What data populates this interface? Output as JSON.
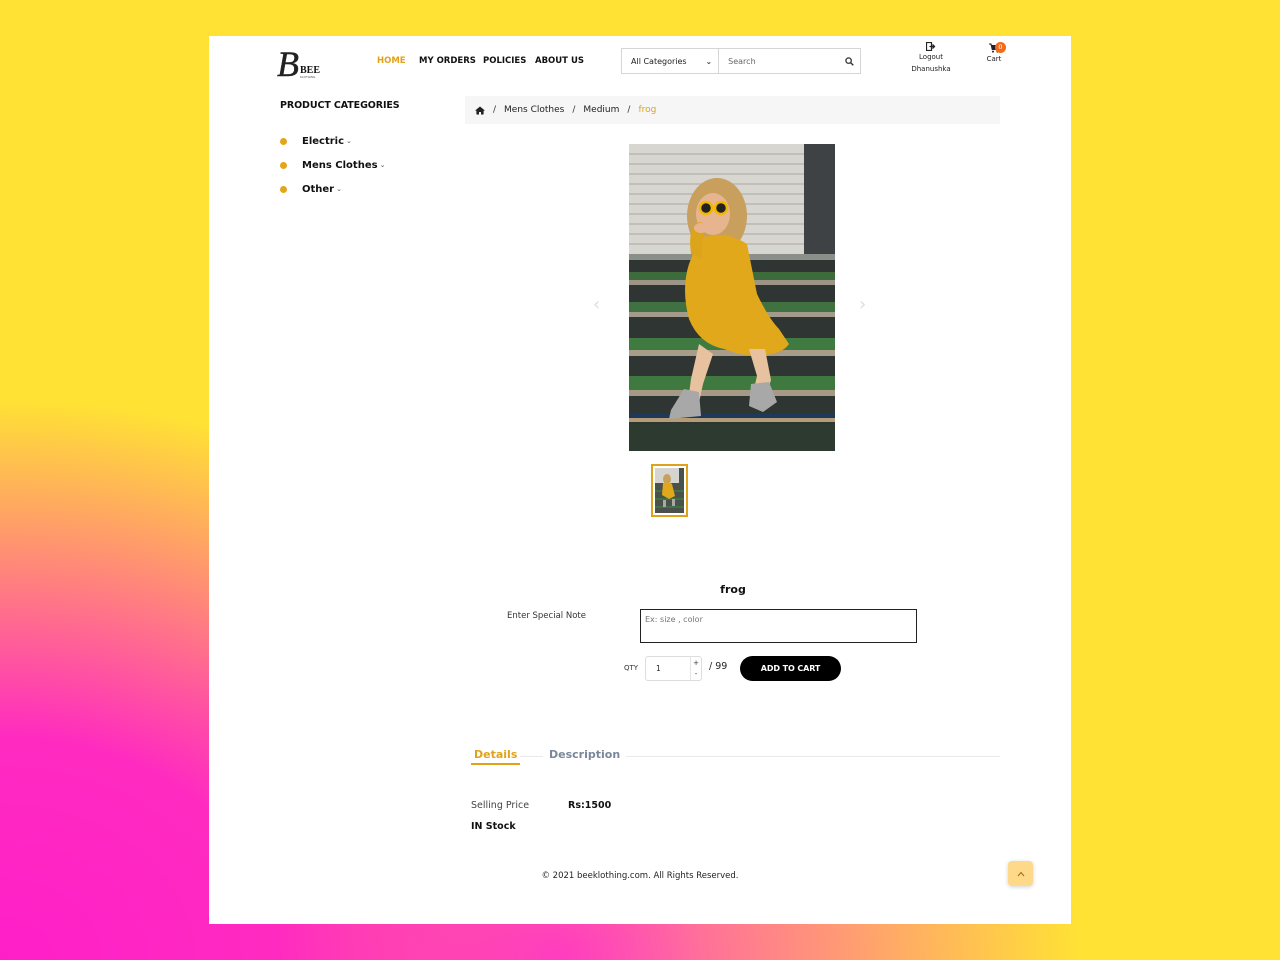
{
  "brand": {
    "logo_letter": "B",
    "logo_text": "BEE",
    "logo_sub": "KLOTHING"
  },
  "nav": {
    "items": [
      {
        "label": "HOME"
      },
      {
        "label": "MY ORDERS"
      },
      {
        "label": "POLICIES"
      },
      {
        "label": "ABOUT US"
      }
    ]
  },
  "search": {
    "category": "All Categories",
    "placeholder": "Search"
  },
  "account": {
    "logout": "Logout",
    "user": "Dhanushka"
  },
  "cart": {
    "label": "Cart",
    "count": "0"
  },
  "sidebar": {
    "title": "PRODUCT CATEGORIES",
    "items": [
      {
        "label": "Electric"
      },
      {
        "label": "Mens Clothes"
      },
      {
        "label": "Other"
      }
    ]
  },
  "breadcrumb": {
    "items": [
      "Mens Clothes",
      "Medium"
    ],
    "current": "frog",
    "separator": "/"
  },
  "product": {
    "title": "frog",
    "note_label": "Enter Special Note",
    "note_placeholder": "Ex: size , color",
    "qty_label": "QTY",
    "qty_value": "1",
    "qty_max": "/ 99",
    "add_to_cart": "ADD TO CART"
  },
  "tabs": {
    "details": "Details",
    "description": "Description"
  },
  "details": {
    "price_label": "Selling Price",
    "price_value": "Rs:1500",
    "stock": "IN Stock"
  },
  "footer": {
    "copyright": "© 2021 beeklothing.com. All Rights Reserved."
  },
  "colors": {
    "accent": "#e0a21a",
    "badge": "#f26a1b",
    "bg_yellow": "#ffe234",
    "bg_pink": "#ff1fc8"
  }
}
